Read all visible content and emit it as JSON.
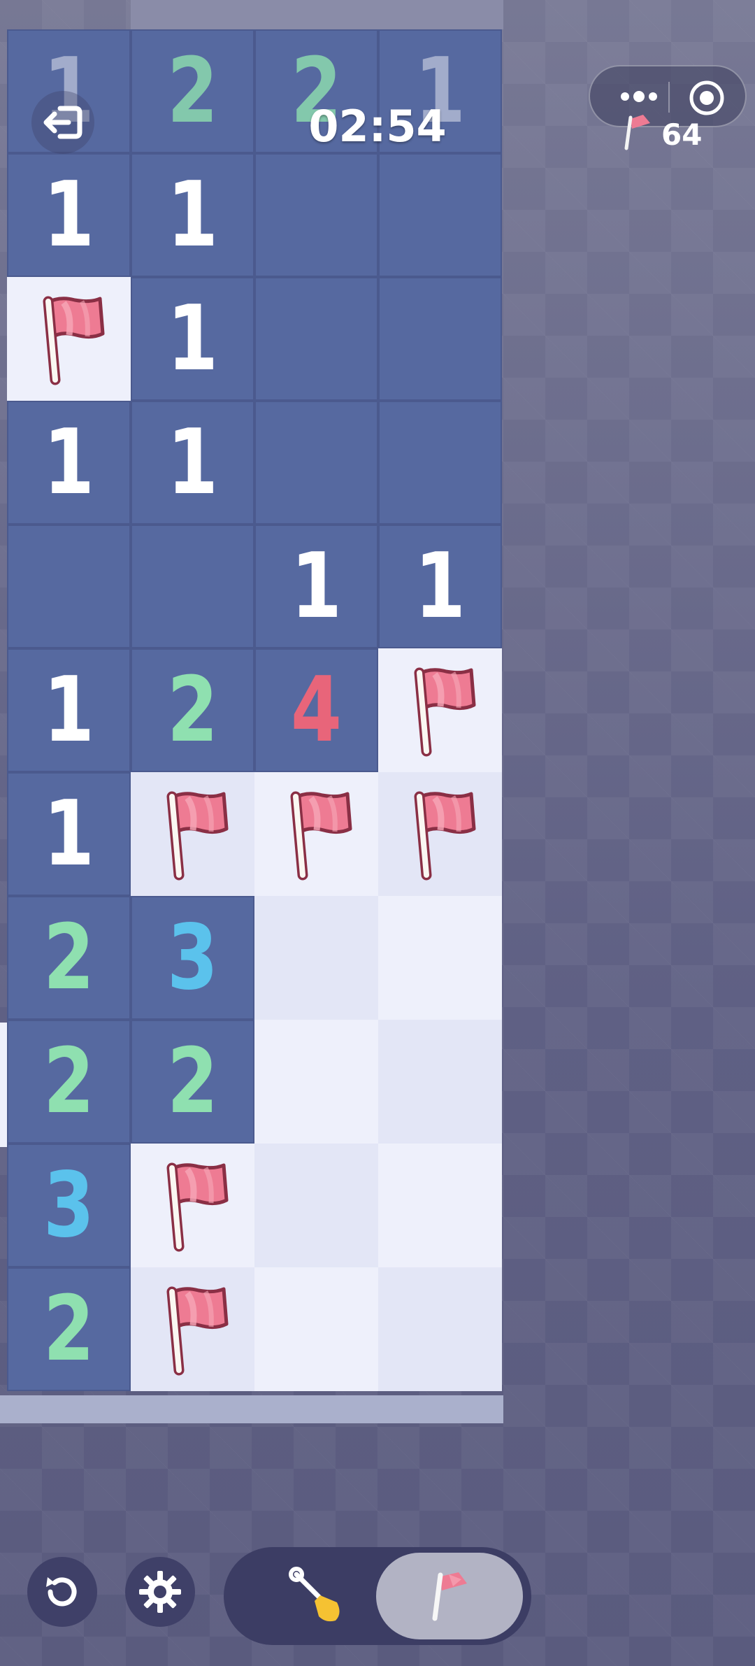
{
  "hud": {
    "timer": "02:54",
    "flags_remaining": "64"
  },
  "colors": {
    "revealed": "#5669a0",
    "hidden_light": "#eef0fb",
    "hidden_alt": "#e3e6f6",
    "num_1": "#ffffff",
    "num_2": "#8fe0b0",
    "num_3": "#5bc2ec",
    "num_4": "#e8657a",
    "flag": "#ee7b93"
  },
  "board": {
    "rows": [
      [
        "1",
        "2",
        "2",
        "1"
      ],
      [
        "1",
        "1",
        "",
        ""
      ],
      [
        "F",
        "1",
        "",
        ""
      ],
      [
        "1",
        "1",
        "",
        ""
      ],
      [
        "",
        "",
        "1",
        "1"
      ],
      [
        "1",
        "2",
        "4",
        "F"
      ],
      [
        "1",
        "F",
        "F",
        "F"
      ],
      [
        "2",
        "3",
        "H",
        "H"
      ],
      [
        "2",
        "2",
        "H",
        "H"
      ],
      [
        "3",
        "F",
        "H",
        "H"
      ],
      [
        "2",
        "F",
        "H",
        "H"
      ]
    ]
  },
  "tools": {
    "restart": "restart-icon",
    "settings": "gear-icon",
    "dig": "shovel-icon",
    "flag": "flag-icon",
    "active": "flag"
  }
}
